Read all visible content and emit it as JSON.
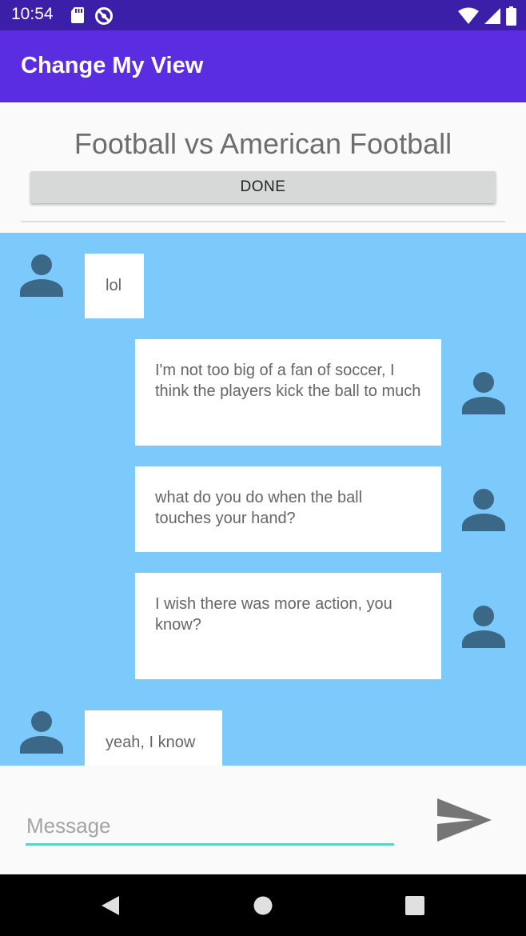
{
  "status_bar": {
    "time": "10:54",
    "left_icons": [
      "sd-card-icon",
      "do-not-disturb-icon"
    ],
    "right_icons": [
      "wifi-icon",
      "signal-icon",
      "battery-icon"
    ]
  },
  "app_bar": {
    "title": "Change My View"
  },
  "topic": {
    "title": "Football vs American Football",
    "done_label": "DONE"
  },
  "messages": [
    {
      "side": "left",
      "text": "lol"
    },
    {
      "side": "right",
      "text": "I'm not too big of a fan of soccer, I think the players kick the ball to much"
    },
    {
      "side": "right",
      "text": "what do you do when the ball touches your hand?"
    },
    {
      "side": "right",
      "text": "I wish there was more action, you know?"
    },
    {
      "side": "left",
      "text": "yeah, I know"
    }
  ],
  "composer": {
    "placeholder": "Message",
    "value": "",
    "send_icon": "send-icon"
  },
  "nav_bar": {
    "icons": [
      "back-icon",
      "home-icon",
      "recents-icon"
    ]
  },
  "colors": {
    "status_bar": "#3b1fa8",
    "app_bar": "#5b2de0",
    "chat_background": "#7ccafb",
    "avatar": "#3b6887",
    "input_underline": "#5fd1c6",
    "send_icon": "#757575"
  }
}
